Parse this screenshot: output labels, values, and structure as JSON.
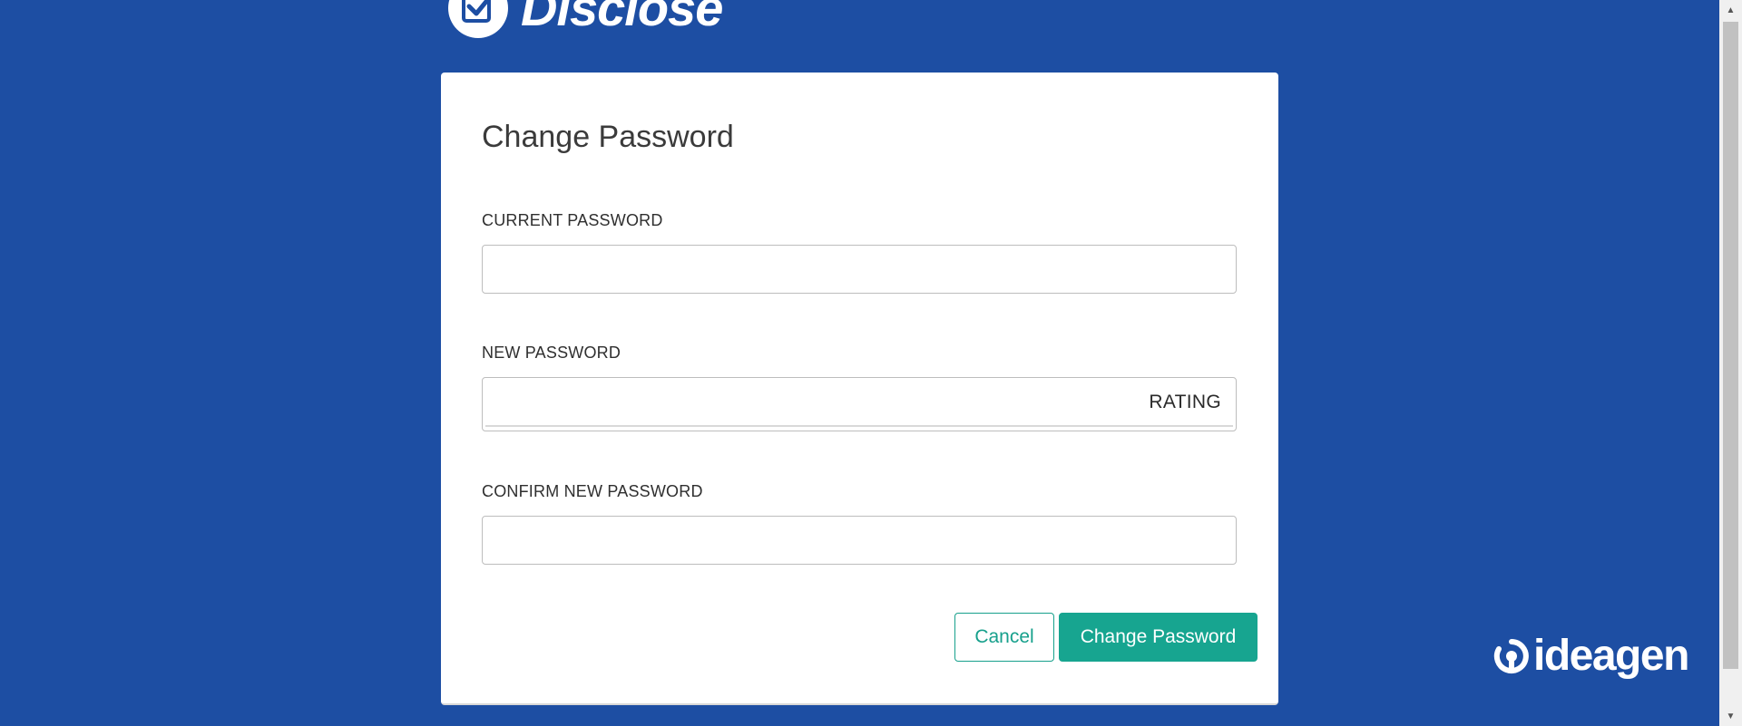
{
  "brand": {
    "app_name": "Disclose",
    "company_name": "ideagen",
    "colors": {
      "background": "#1d4ea3",
      "accent": "#17a590",
      "card": "#ffffff"
    }
  },
  "form": {
    "title": "Change Password",
    "current_password": {
      "label": "CURRENT PASSWORD",
      "value": "",
      "placeholder": ""
    },
    "new_password": {
      "label": "NEW PASSWORD",
      "value": "",
      "placeholder": "",
      "rating_label": "RATING",
      "strength_fraction": 0
    },
    "confirm_password": {
      "label": "CONFIRM NEW PASSWORD",
      "value": "",
      "placeholder": ""
    },
    "cancel_label": "Cancel",
    "submit_label": "Change Password"
  },
  "icons": {
    "logo": "checkbox-icon",
    "company": "ideagen-mark-icon",
    "scroll_up": "triangle-up-icon",
    "scroll_down": "triangle-down-icon"
  }
}
